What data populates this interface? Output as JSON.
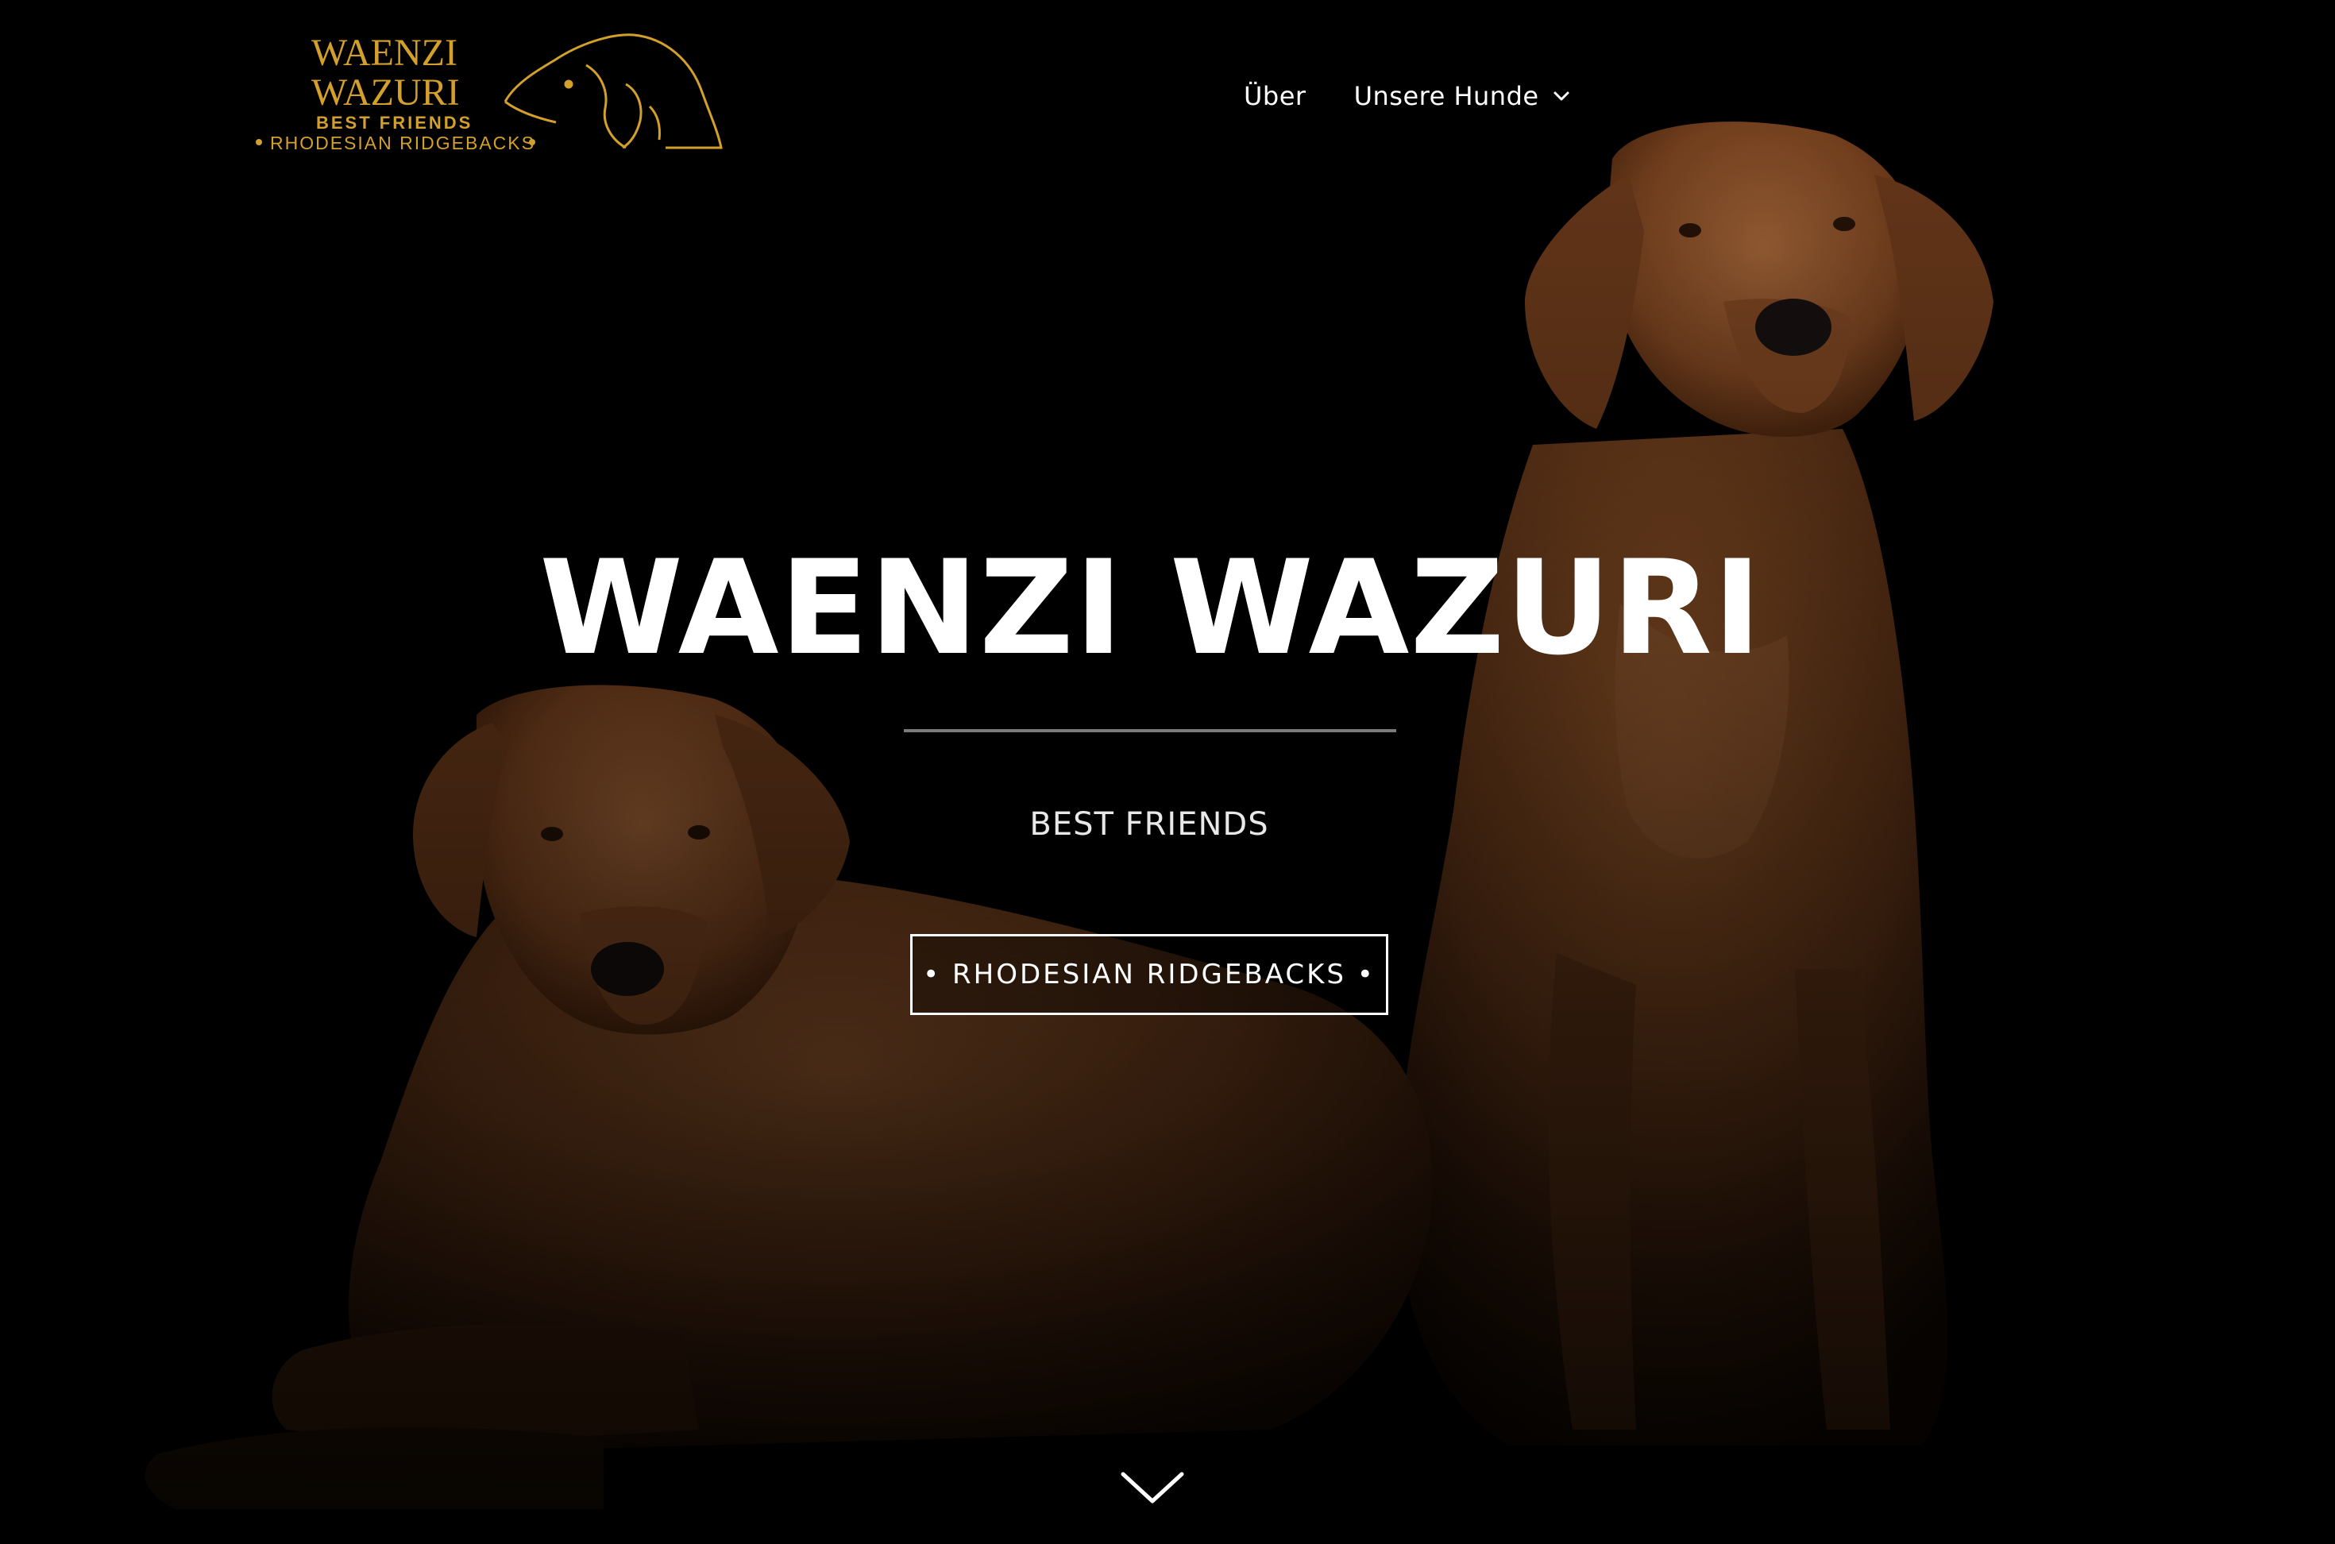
{
  "logo": {
    "line1": "WAENZI",
    "line2": "WAZURI",
    "line3": "BEST FRIENDS",
    "line4": "RHODESIAN RIDGEBACKS",
    "color": "#d4a02c"
  },
  "nav": {
    "items": [
      {
        "label": "Über",
        "has_dropdown": false
      },
      {
        "label": "Unsere Hunde",
        "has_dropdown": true,
        "icon": "chevron-down-icon"
      }
    ]
  },
  "hero": {
    "title": "WAENZI WAZURI",
    "subtitle": "BEST FRIENDS",
    "button_label": "• RHODESIAN RIDGEBACKS •",
    "scroll_icon": "chevron-down-icon",
    "background": "photo of two rhodesian ridgeback dogs on black background"
  },
  "colors": {
    "background": "#000000",
    "text": "#ffffff",
    "accent_gold": "#d4a02c",
    "dog_fur": "#8a4f26",
    "divider": "#7a7a7a"
  }
}
